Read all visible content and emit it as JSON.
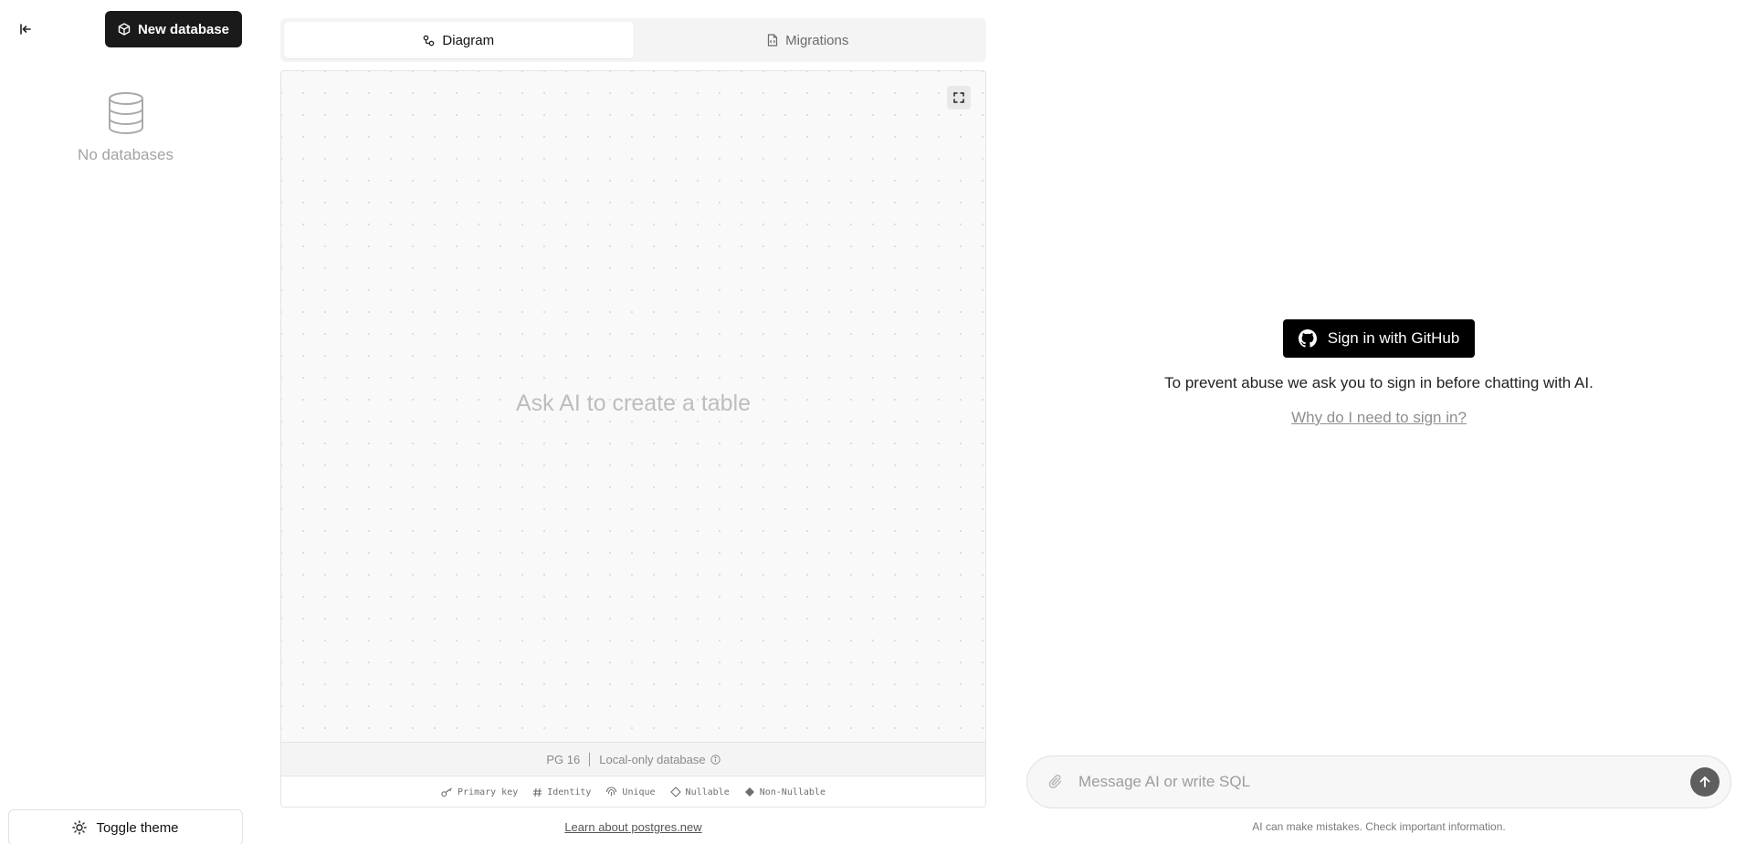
{
  "sidebar": {
    "collapse_icon": "collapse-left-icon",
    "new_database_label": "New database",
    "empty_state": {
      "icon": "database-icon",
      "label": "No databases"
    },
    "toggle_theme_label": "Toggle theme"
  },
  "tabs": [
    {
      "label": "Diagram",
      "icon": "diagram-icon",
      "active": true
    },
    {
      "label": "Migrations",
      "icon": "file-code-icon",
      "active": false
    }
  ],
  "canvas": {
    "hint": "Ask AI to create a table",
    "footer": {
      "version": "PG 16",
      "mode": "Local-only database"
    },
    "legend": [
      "Primary key",
      "Identity",
      "Unique",
      "Nullable",
      "Non-Nullable"
    ]
  },
  "learn_link": "Learn about postgres.new",
  "signin": {
    "button_label": "Sign in with GitHub",
    "message": "To prevent abuse we ask you to sign in before chatting with AI.",
    "why_link": "Why do I need to sign in?"
  },
  "chat": {
    "placeholder": "Message AI or write SQL",
    "disclaimer": "AI can make mistakes. Check important information."
  },
  "colors": {
    "primary": "#1a1a1a",
    "github": "#000000",
    "muted": "#a3a3a3"
  }
}
